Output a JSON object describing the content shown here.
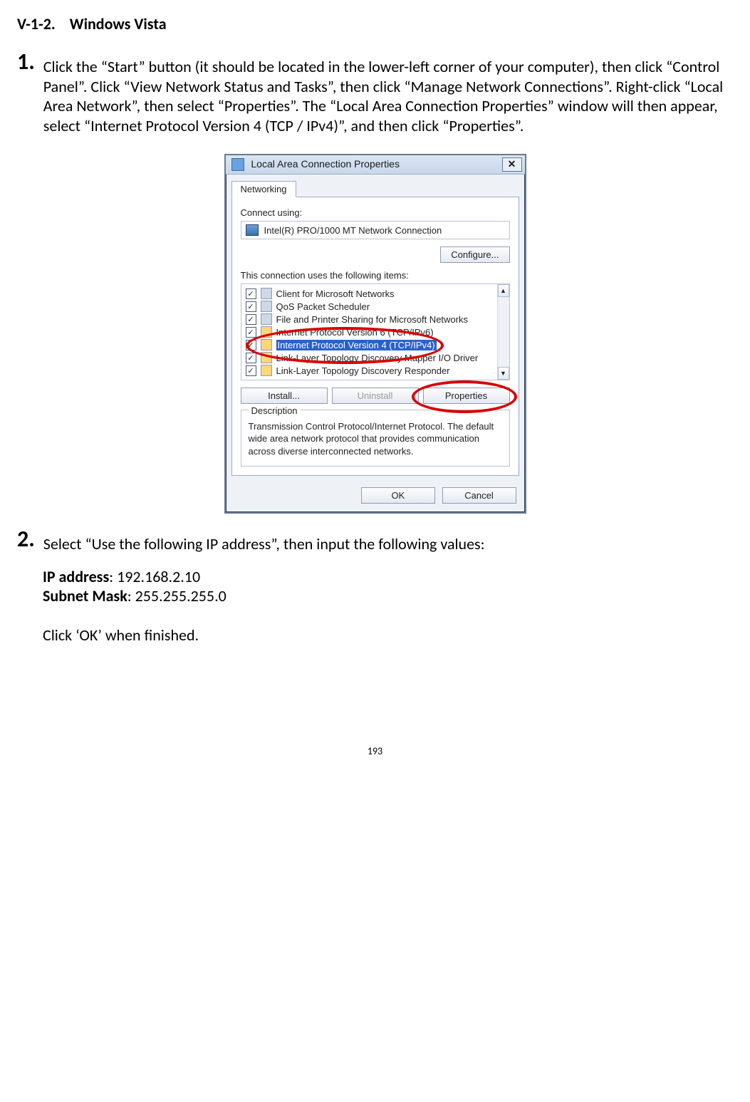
{
  "section": {
    "number": "V-1-2.",
    "title": "Windows Vista"
  },
  "step1": {
    "number": "1.",
    "text": "Click the “Start” button (it should be located in the lower-left corner of your computer), then click “Control Panel”. Click “View Network Status and Tasks”, then click “Manage Network Connections”. Right-click “Local Area Network”, then select “Properties”. The “Local Area Connection Properties” window will then appear, select “Internet Protocol Version 4 (TCP / IPv4)”, and then click “Properties”."
  },
  "dialog": {
    "title": "Local Area Connection Properties",
    "close": "✕",
    "tab": "Networking",
    "connect_using_label": "Connect using:",
    "adapter": "Intel(R) PRO/1000 MT Network Connection",
    "configure_button": "Configure...",
    "items_label": "This connection uses the following items:",
    "items": [
      {
        "label": "Client for Microsoft Networks"
      },
      {
        "label": "QoS Packet Scheduler"
      },
      {
        "label": "File and Printer Sharing for Microsoft Networks"
      },
      {
        "label": "Internet Protocol Version 6 (TCP/IPv6)"
      },
      {
        "label": "Internet Protocol Version 4 (TCP/IPv4)"
      },
      {
        "label": "Link-Layer Topology Discovery Mapper I/O Driver"
      },
      {
        "label": "Link-Layer Topology Discovery Responder"
      }
    ],
    "install_button": "Install...",
    "uninstall_button": "Uninstall",
    "properties_button": "Properties",
    "description_legend": "Description",
    "description_text": "Transmission Control Protocol/Internet Protocol. The default wide area network protocol that provides communication across diverse interconnected networks.",
    "ok_button": "OK",
    "cancel_button": "Cancel"
  },
  "step2": {
    "number": "2.",
    "text": "Select “Use the following IP address”, then input the following values:",
    "ip_label": "IP address",
    "ip_value": ": 192.168.2.10",
    "mask_label": "Subnet Mask",
    "mask_value": ": 255.255.255.0",
    "finish_text": "Click ‘OK’ when finished."
  },
  "page_number": "193"
}
